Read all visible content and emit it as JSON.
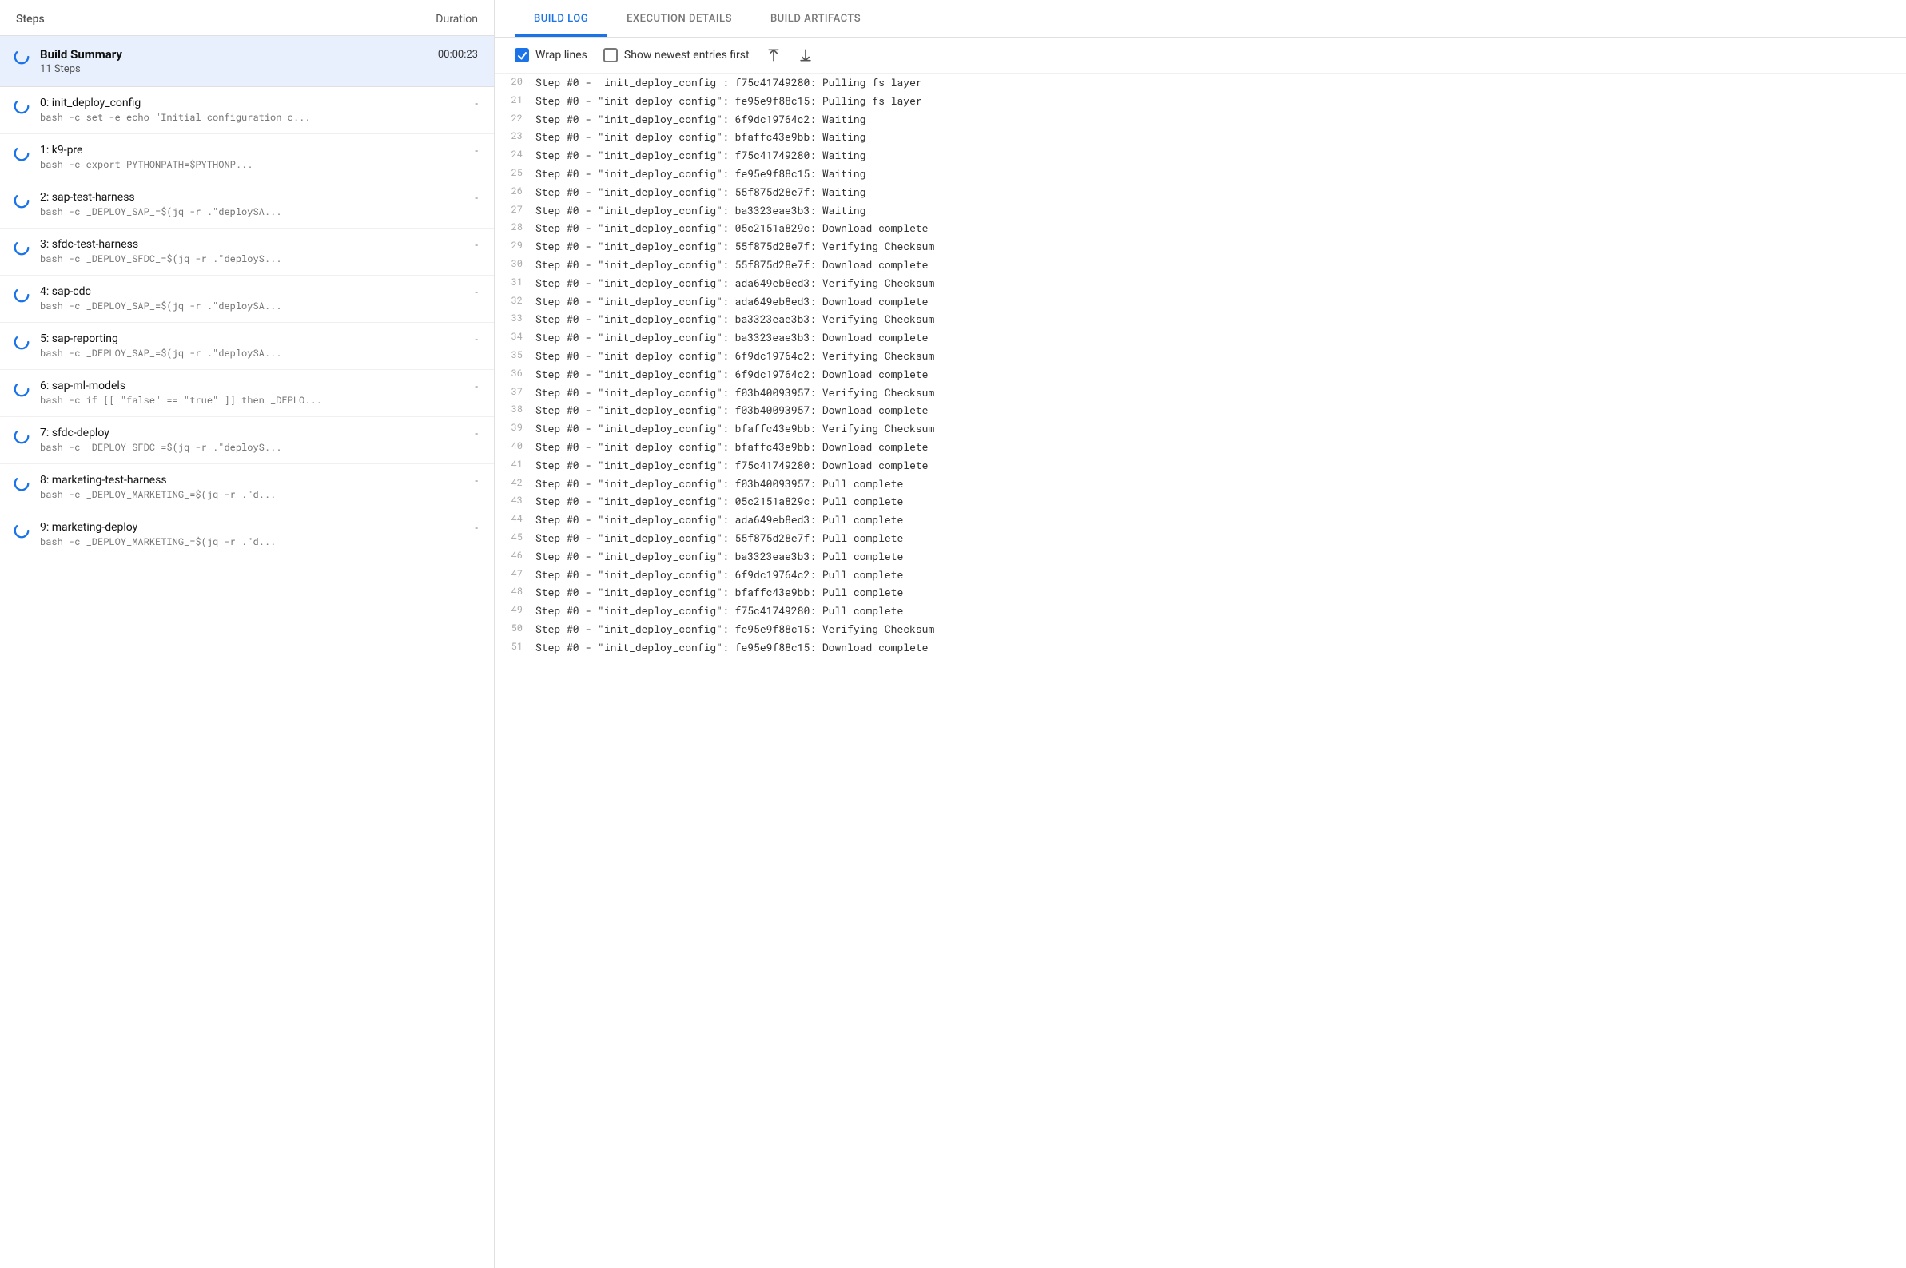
{
  "left_panel": {
    "header": {
      "steps_label": "Steps",
      "duration_label": "Duration"
    },
    "build_summary": {
      "title": "Build Summary",
      "subtitle": "11 Steps",
      "duration": "00:00:23"
    },
    "steps": [
      {
        "id": 0,
        "name": "0: init_deploy_config",
        "command": "bash -c set -e echo \"Initial configuration c...",
        "duration": "-"
      },
      {
        "id": 1,
        "name": "1: k9-pre",
        "command": "bash -c export PYTHONPATH=$PYTHONP...",
        "duration": "-"
      },
      {
        "id": 2,
        "name": "2: sap-test-harness",
        "command": "bash -c _DEPLOY_SAP_=$(jq -r .\"deploySA...",
        "duration": "-"
      },
      {
        "id": 3,
        "name": "3: sfdc-test-harness",
        "command": "bash -c _DEPLOY_SFDC_=$(jq -r .\"deployS...",
        "duration": "-"
      },
      {
        "id": 4,
        "name": "4: sap-cdc",
        "command": "bash -c _DEPLOY_SAP_=$(jq -r .\"deploySA...",
        "duration": "-"
      },
      {
        "id": 5,
        "name": "5: sap-reporting",
        "command": "bash -c _DEPLOY_SAP_=$(jq -r .\"deploySA...",
        "duration": "-"
      },
      {
        "id": 6,
        "name": "6: sap-ml-models",
        "command": "bash -c if [[ \"false\" == \"true\" ]] then _DEPLO...",
        "duration": "-"
      },
      {
        "id": 7,
        "name": "7: sfdc-deploy",
        "command": "bash -c _DEPLOY_SFDC_=$(jq -r .\"deployS...",
        "duration": "-"
      },
      {
        "id": 8,
        "name": "8: marketing-test-harness",
        "command": "bash -c _DEPLOY_MARKETING_=$(jq -r .\"d...",
        "duration": "-"
      },
      {
        "id": 9,
        "name": "9: marketing-deploy",
        "command": "bash -c _DEPLOY_MARKETING_=$(jq -r .\"d...",
        "duration": "-"
      }
    ]
  },
  "right_panel": {
    "tabs": [
      {
        "id": "build-log",
        "label": "BUILD LOG",
        "active": true
      },
      {
        "id": "execution-details",
        "label": "EXECUTION DETAILS",
        "active": false
      },
      {
        "id": "build-artifacts",
        "label": "BUILD ARTIFACTS",
        "active": false
      }
    ],
    "toolbar": {
      "wrap_lines_label": "Wrap lines",
      "wrap_lines_checked": true,
      "show_newest_label": "Show newest entries first",
      "show_newest_checked": false,
      "scroll_top_label": "Scroll to top",
      "scroll_bottom_label": "Scroll to bottom"
    },
    "log_lines": [
      {
        "num": 20,
        "text": "Step #0 -  init_deploy_config : f75c41749280: Pulling fs layer"
      },
      {
        "num": 21,
        "text": "Step #0 - \"init_deploy_config\": fe95e9f88c15: Pulling fs layer"
      },
      {
        "num": 22,
        "text": "Step #0 - \"init_deploy_config\": 6f9dc19764c2: Waiting"
      },
      {
        "num": 23,
        "text": "Step #0 - \"init_deploy_config\": bfaffc43e9bb: Waiting"
      },
      {
        "num": 24,
        "text": "Step #0 - \"init_deploy_config\": f75c41749280: Waiting"
      },
      {
        "num": 25,
        "text": "Step #0 - \"init_deploy_config\": fe95e9f88c15: Waiting"
      },
      {
        "num": 26,
        "text": "Step #0 - \"init_deploy_config\": 55f875d28e7f: Waiting"
      },
      {
        "num": 27,
        "text": "Step #0 - \"init_deploy_config\": ba3323eae3b3: Waiting"
      },
      {
        "num": 28,
        "text": "Step #0 - \"init_deploy_config\": 05c2151a829c: Download complete"
      },
      {
        "num": 29,
        "text": "Step #0 - \"init_deploy_config\": 55f875d28e7f: Verifying Checksum"
      },
      {
        "num": 30,
        "text": "Step #0 - \"init_deploy_config\": 55f875d28e7f: Download complete"
      },
      {
        "num": 31,
        "text": "Step #0 - \"init_deploy_config\": ada649eb8ed3: Verifying Checksum"
      },
      {
        "num": 32,
        "text": "Step #0 - \"init_deploy_config\": ada649eb8ed3: Download complete"
      },
      {
        "num": 33,
        "text": "Step #0 - \"init_deploy_config\": ba3323eae3b3: Verifying Checksum"
      },
      {
        "num": 34,
        "text": "Step #0 - \"init_deploy_config\": ba3323eae3b3: Download complete"
      },
      {
        "num": 35,
        "text": "Step #0 - \"init_deploy_config\": 6f9dc19764c2: Verifying Checksum"
      },
      {
        "num": 36,
        "text": "Step #0 - \"init_deploy_config\": 6f9dc19764c2: Download complete"
      },
      {
        "num": 37,
        "text": "Step #0 - \"init_deploy_config\": f03b40093957: Verifying Checksum"
      },
      {
        "num": 38,
        "text": "Step #0 - \"init_deploy_config\": f03b40093957: Download complete"
      },
      {
        "num": 39,
        "text": "Step #0 - \"init_deploy_config\": bfaffc43e9bb: Verifying Checksum"
      },
      {
        "num": 40,
        "text": "Step #0 - \"init_deploy_config\": bfaffc43e9bb: Download complete"
      },
      {
        "num": 41,
        "text": "Step #0 - \"init_deploy_config\": f75c41749280: Download complete"
      },
      {
        "num": 42,
        "text": "Step #0 - \"init_deploy_config\": f03b40093957: Pull complete"
      },
      {
        "num": 43,
        "text": "Step #0 - \"init_deploy_config\": 05c2151a829c: Pull complete"
      },
      {
        "num": 44,
        "text": "Step #0 - \"init_deploy_config\": ada649eb8ed3: Pull complete"
      },
      {
        "num": 45,
        "text": "Step #0 - \"init_deploy_config\": 55f875d28e7f: Pull complete"
      },
      {
        "num": 46,
        "text": "Step #0 - \"init_deploy_config\": ba3323eae3b3: Pull complete"
      },
      {
        "num": 47,
        "text": "Step #0 - \"init_deploy_config\": 6f9dc19764c2: Pull complete"
      },
      {
        "num": 48,
        "text": "Step #0 - \"init_deploy_config\": bfaffc43e9bb: Pull complete"
      },
      {
        "num": 49,
        "text": "Step #0 - \"init_deploy_config\": f75c41749280: Pull complete"
      },
      {
        "num": 50,
        "text": "Step #0 - \"init_deploy_config\": fe95e9f88c15: Verifying Checksum"
      },
      {
        "num": 51,
        "text": "Step #0 - \"init_deploy_config\": fe95e9f88c15: Download complete"
      }
    ]
  }
}
